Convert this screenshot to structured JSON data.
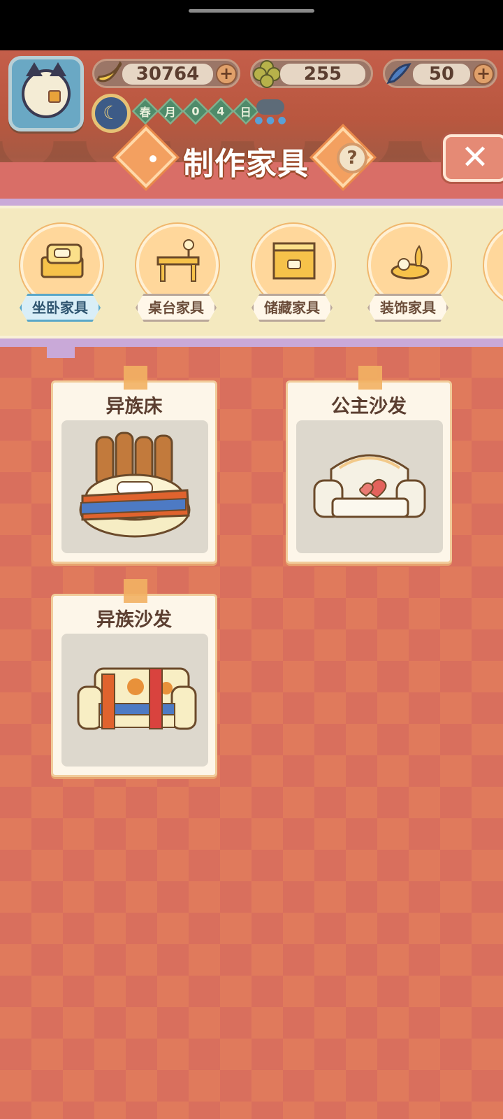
{
  "header": {
    "title": "制作家具",
    "resources": [
      {
        "name": "banana",
        "icon": "banana-icon",
        "value": "30764"
      },
      {
        "name": "clover",
        "icon": "clover-icon",
        "value": "255"
      },
      {
        "name": "blue-fish",
        "icon": "fish-icon",
        "value": "50"
      }
    ],
    "plus_label": "+",
    "date": [
      "春",
      "月",
      "0",
      "4",
      "日"
    ],
    "help_label": "?",
    "close_label": "✕"
  },
  "tabs": [
    {
      "label": "坐卧家具",
      "icon": "bed-icon",
      "active": true
    },
    {
      "label": "桌台家具",
      "icon": "desk-icon",
      "active": false
    },
    {
      "label": "储藏家具",
      "icon": "cabinet-icon",
      "active": false
    },
    {
      "label": "装饰家具",
      "icon": "decor-icon",
      "active": false
    }
  ],
  "items": [
    {
      "name": "异族床",
      "icon": "exotic-bed-icon"
    },
    {
      "name": "公主沙发",
      "icon": "princess-sofa-icon"
    },
    {
      "name": "异族沙发",
      "icon": "exotic-sofa-icon"
    }
  ],
  "colors": {
    "background": "#e07a5c",
    "tab_active": "#5aa7c8",
    "title_stroke": "#9c4b2c"
  }
}
